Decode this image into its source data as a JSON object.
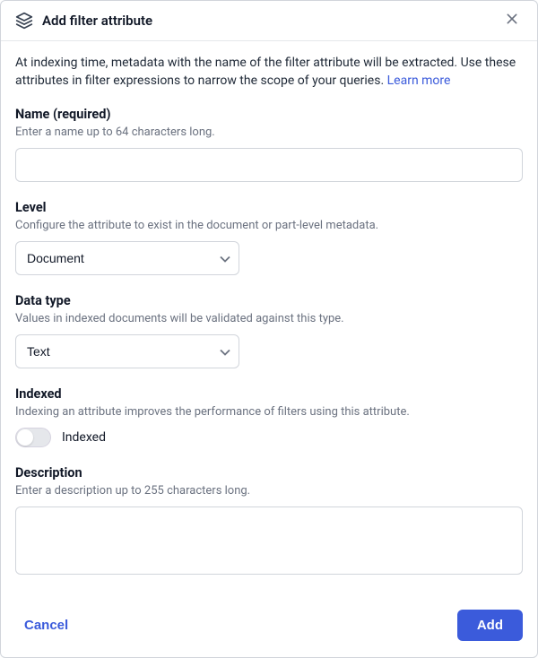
{
  "header": {
    "title": "Add filter attribute"
  },
  "intro": {
    "text": "At indexing time, metadata with the name of the filter attribute will be extracted. Use these attributes in filter expressions to narrow the scope of your queries. ",
    "link_text": "Learn more"
  },
  "fields": {
    "name": {
      "label": "Name (required)",
      "help": "Enter a name up to 64 characters long.",
      "value": ""
    },
    "level": {
      "label": "Level",
      "help": "Configure the attribute to exist in the document or part-level metadata.",
      "value": "Document"
    },
    "data_type": {
      "label": "Data type",
      "help": "Values in indexed documents will be validated against this type.",
      "value": "Text"
    },
    "indexed": {
      "label": "Indexed",
      "help": "Indexing an attribute improves the performance of filters using this attribute.",
      "toggle_label": "Indexed",
      "on": false
    },
    "description": {
      "label": "Description",
      "help": "Enter a description up to 255 characters long.",
      "value": ""
    }
  },
  "footer": {
    "cancel": "Cancel",
    "submit": "Add"
  }
}
